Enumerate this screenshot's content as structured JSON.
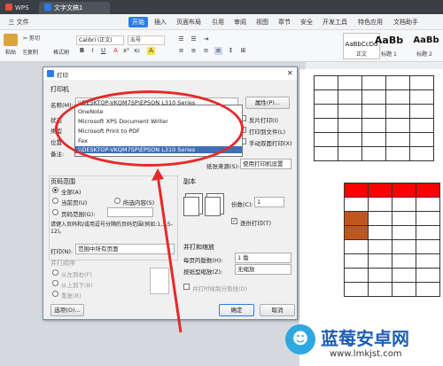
{
  "titlebar": {
    "app_tab": "WPS",
    "doc_tab": "文字文稿1"
  },
  "menubar": {
    "file": "三 文件",
    "items": [
      "开始",
      "插入",
      "页面布局",
      "引用",
      "审阅",
      "视图",
      "章节",
      "安全",
      "开发工具",
      "特色应用",
      "文档助手"
    ]
  },
  "ribbon": {
    "paste": "粘贴",
    "cut": "剪切",
    "copy": "复制",
    "format_painter": "格式刷",
    "font_name": "Calibri (正文)",
    "font_size": "五号",
    "styles": [
      {
        "preview": "AaBbCcDd",
        "label": "正文"
      },
      {
        "preview": "AaBb",
        "label": "标题 1"
      },
      {
        "preview": "AaBb",
        "label": "标题 2"
      }
    ]
  },
  "dialog": {
    "title": "打印",
    "printer_section": "打印机",
    "name_label": "名称(M):",
    "printer_selected": "\\\\DESKTOP-VKQM7SP\\EPSON L310 Series",
    "properties_button": "属性(P)...",
    "status_label": "状态",
    "type_label": "类型",
    "where_label": "位置",
    "comment_label": "备注:",
    "printer_options": [
      "OneNote",
      "Microsoft XPS Document Writer",
      "Microsoft Print to PDF",
      "Fax",
      "\\\\DESKTOP-VKQM7SP\\EPSON L310 Series"
    ],
    "reverse_print": "反片打印(I)",
    "print_to_file": "打印到文件(L)",
    "manual_duplex": "手动双面打印(X)",
    "paper_source_label": "纸张来源(S):",
    "paper_source_value": "使用打印机设置",
    "page_range_section": "页码范围",
    "all_pages": "全部(A)",
    "current_page": "当前页(U)",
    "selection": "所选内容(S)",
    "page_range": "页码范围(G):",
    "page_hint": "请键入页码和/或用逗号分隔的页码范围(例如:1,3,5-12)。",
    "print_label": "打印(N):",
    "print_value": "范围中所有页面",
    "copies_section": "副本",
    "copies_label": "份数(C):",
    "copies_value": "1",
    "collate": "逐份打印(T)",
    "zoom_section": "并打和缩放",
    "pages_per_sheet_label": "每页的版数(H):",
    "pages_per_sheet_value": "1 版",
    "scale_label": "按纸型缩放(Z):",
    "scale_value": "无缩放",
    "order_section": "并打顺序",
    "order_lr": "从左到右(F)",
    "order_tb": "从上到下(B)",
    "order_repeat": "重复(R)",
    "draw_borders": "并打时绘制分割线(D)",
    "options_button": "选项(O)...",
    "ok_button": "确定",
    "cancel_button": "取消"
  },
  "watermark": {
    "brand": "蓝莓安卓网",
    "url": "www.lmkjst.com"
  },
  "colors": {
    "accent": "#2b7de9",
    "annotation": "#e52a2a",
    "header_red": "#ff0000",
    "cell_brown": "#c0561f"
  }
}
